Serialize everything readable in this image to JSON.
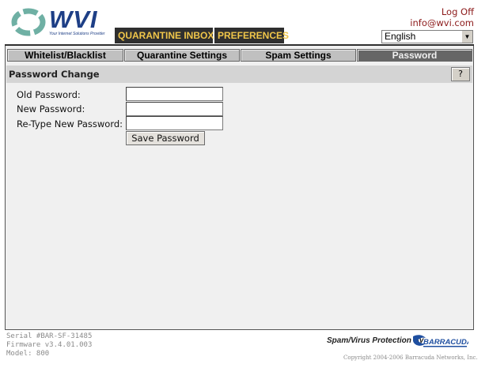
{
  "header": {
    "logo_text": "WVI",
    "logo_tagline": "Your Internet Solutions Provider",
    "tabs": [
      {
        "label": "QUARANTINE INBOX"
      },
      {
        "label": "PREFERENCES",
        "active": true
      }
    ],
    "logoff_label": "Log Off",
    "user_email": "info@wvi.com",
    "language": {
      "selected": "English"
    }
  },
  "subtabs": [
    {
      "label": "Whitelist/Blacklist"
    },
    {
      "label": "Quarantine Settings"
    },
    {
      "label": "Spam Settings"
    },
    {
      "label": "Password",
      "active": true
    }
  ],
  "section": {
    "title": "Password Change",
    "help_label": "?"
  },
  "form": {
    "fields": [
      {
        "label": "Old Password:",
        "value": ""
      },
      {
        "label": "New Password:",
        "value": ""
      },
      {
        "label": "Re-Type New Password:",
        "value": ""
      }
    ],
    "submit_label": "Save Password"
  },
  "footer": {
    "serial": "Serial #BAR-SF-31485",
    "firmware": "Firmware v3.4.01.003",
    "model": "Model: 800",
    "protection_text": "Spam/Virus Protection By",
    "brand_logo_text": "BARRACUDA",
    "copyright": "Copyright 2004-2006 Barracuda Networks, Inc."
  },
  "colors": {
    "tab_bg": "#2f2f2f",
    "tab_text": "#f0c64a",
    "link": "#8c1a1a",
    "logo_blue": "#1e3f86",
    "active_subtab": "#666666"
  }
}
